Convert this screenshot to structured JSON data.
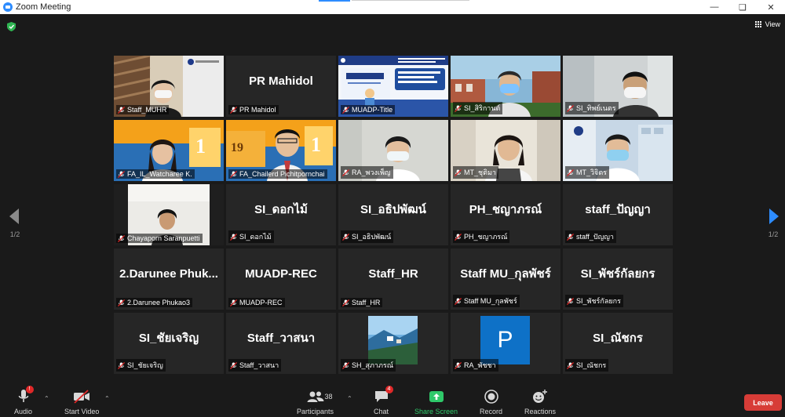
{
  "window": {
    "title": "Zoom Meeting"
  },
  "top": {
    "view_label": "View"
  },
  "nav": {
    "page_left": "1/2",
    "page_right": "1/2"
  },
  "tiles": [
    {
      "name": "Staff_MUHR",
      "big": "",
      "video": "office"
    },
    {
      "name": "PR Mahidol",
      "big": "PR Mahidol",
      "video": ""
    },
    {
      "name": "MUADP-Title",
      "big": "",
      "video": "slide"
    },
    {
      "name": "SI_สิริกานต์",
      "big": "",
      "video": "outdoor"
    },
    {
      "name": "SI_ทิพย์เนตร",
      "big": "",
      "video": "room"
    },
    {
      "name": "FA_IL_Watcharee K.",
      "big": "",
      "video": "orange"
    },
    {
      "name": "FA_Chailerd Pichitpornchai",
      "big": "",
      "video": "orange2"
    },
    {
      "name": "RA_พวงเพ็ญ",
      "big": "",
      "video": "plain"
    },
    {
      "name": "MT_ชุติมา",
      "big": "",
      "video": "lab"
    },
    {
      "name": "MT_วิจิตร",
      "big": "",
      "video": "bright"
    },
    {
      "name": "Chayaporn Saranpuetti",
      "big": "",
      "video": "wall"
    },
    {
      "name": "SI_ดอกไม้",
      "big": "SI_ดอกไม้",
      "video": ""
    },
    {
      "name": "SI_อธิปพัฒน์",
      "big": "SI_อธิปพัฒน์",
      "video": ""
    },
    {
      "name": "PH_ชญาภรณ์",
      "big": "PH_ชญาภรณ์",
      "video": ""
    },
    {
      "name": "staff_ปัญญา",
      "big": "staff_ปัญญา",
      "video": ""
    },
    {
      "name": "2.Darunee Phukao3",
      "big": "2.Darunee  Phuk...",
      "video": ""
    },
    {
      "name": "MUADP-REC",
      "big": "MUADP-REC",
      "video": ""
    },
    {
      "name": "Staff_HR",
      "big": "Staff_HR",
      "video": ""
    },
    {
      "name": "Staff MU_กุลพัชร์",
      "big": "Staff MU_กุลพัชร์",
      "video": ""
    },
    {
      "name": "SI_พัชร์กัลยกร",
      "big": "SI_พัชร์กัลยกร",
      "video": ""
    },
    {
      "name": "SI_ชัยเจริญ",
      "big": "SI_ชัยเจริญ",
      "video": ""
    },
    {
      "name": "Staff_วาสนา",
      "big": "Staff_วาสนา",
      "video": ""
    },
    {
      "name": "SH_สุภาภรณ์",
      "big": "",
      "video": "photo"
    },
    {
      "name": "RA_พัชชา",
      "big": "",
      "video": "avatar",
      "initial": "P"
    },
    {
      "name": "SI_ณัชกร",
      "big": "SI_ณัชกร",
      "video": ""
    }
  ],
  "slide_text": {
    "brand": "MU-ADP"
  },
  "toolbar": {
    "audio": "Audio",
    "start_video": "Start Video",
    "participants": "Participants",
    "participants_count": "38",
    "chat": "Chat",
    "chat_badge": "4",
    "share_screen": "Share Screen",
    "record": "Record",
    "reactions": "Reactions",
    "leave": "Leave",
    "audio_badge": "!"
  },
  "colors": {
    "active_speaker": "#a8d92a",
    "share": "#2fc96a",
    "leave": "#d73c37",
    "nav_arrow": "#2d8cff"
  }
}
